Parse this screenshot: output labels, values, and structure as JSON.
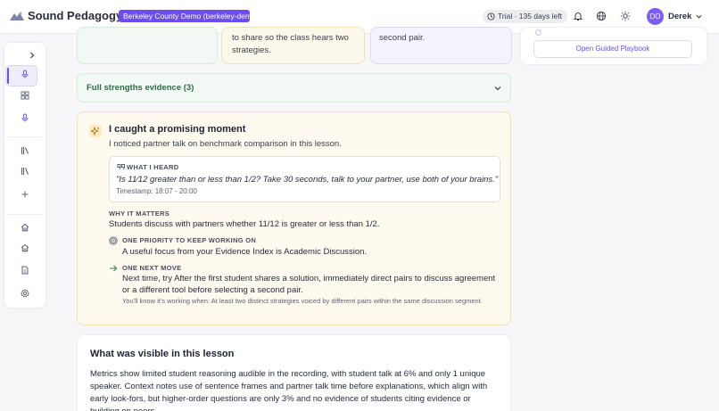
{
  "header": {
    "app_title": "Sound Pedagogy",
    "org_badge": "Berkeley County Demo (berkeley-demo)",
    "trial": "Trial · 135 days left",
    "user_initials": "DO",
    "user_name": "Derek"
  },
  "colors": {
    "accent": "#6d4df2",
    "green_card": "#f2f8f3",
    "amber_card": "#fefaf0",
    "blue_card": "#f2f3fc"
  },
  "sidebar": {
    "items": [
      {
        "icon": "chevron-right-icon"
      },
      {
        "icon": "microphone-icon"
      },
      {
        "icon": "grid-icon"
      },
      {
        "icon": "microphone-icon",
        "active": true
      },
      {
        "icon": "library-icon"
      },
      {
        "icon": "library-icon"
      },
      {
        "icon": "plus-icon"
      },
      {
        "icon": "home-icon"
      },
      {
        "icon": "home-icon"
      },
      {
        "icon": "document-icon"
      },
      {
        "icon": "gear-icon"
      }
    ]
  },
  "top_cards": {
    "card2_text": "to share so the class hears two strategies.",
    "card3_text": "second pair.",
    "playbook_button": "Open Guided Playbook"
  },
  "strengths": {
    "label": "Full strengths evidence (3)"
  },
  "moment": {
    "title": "I caught a promising moment",
    "subtitle": "I noticed partner talk on benchmark comparison in this lesson.",
    "heard_label": "WHAT I HEARD",
    "heard_quote": "\"Is 11⁄12 greater than or less than 1/2? Take 30 seconds, talk to your partner, use both of your brains.\"",
    "timestamp": "Timestamp: 18:07 - 20:00",
    "why_label": "WHY IT MATTERS",
    "why_text": "Students discuss with partners whether 11/12 is greater or less than 1/2.",
    "priority_label": "ONE PRIORITY TO KEEP WORKING ON",
    "priority_text": "A useful focus from your Evidence Index is Academic Discussion.",
    "next_label": "ONE NEXT MOVE",
    "next_text": "Next time, try After the first student shares a solution, immediately direct pairs to discuss agreement or a different tool before selecting a second pair.",
    "working_note": "You'll know it's working when: At least two distinct strategies voiced by different pairs within the same discussion segment."
  },
  "visible": {
    "title": "What was visible in this lesson",
    "text": "Metrics show limited student reasoning audible in the recording, with student talk at 6% and only 1 unique speaker. Context notes use of sentence frames and partner talk time before explanations, which align with early look-fors, but higher-order questions are only 3% and no evidence of students citing evidence or building on peers."
  }
}
